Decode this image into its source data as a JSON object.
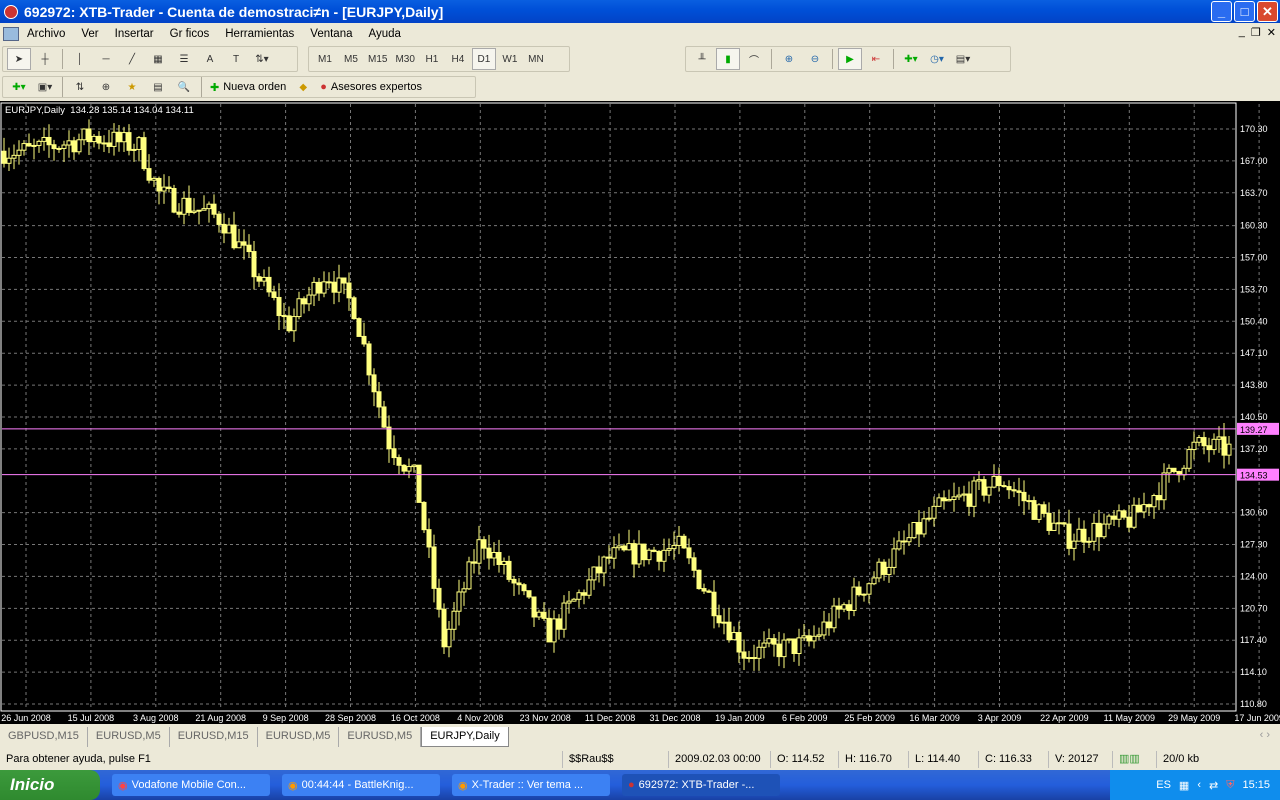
{
  "window": {
    "title": "692972: XTB-Trader - Cuenta de demostraci≠n - [EURJPY,Daily]"
  },
  "menu": [
    "Archivo",
    "Ver",
    "Insertar",
    "Gr ficos",
    "Herramientas",
    "Ventana",
    "Ayuda"
  ],
  "timeframes": [
    "M1",
    "M5",
    "M15",
    "M30",
    "H1",
    "H4",
    "D1",
    "W1",
    "MN"
  ],
  "active_timeframe": "D1",
  "toolbar2": {
    "new_order": "Nueva orden",
    "experts": "Asesores expertos"
  },
  "chart": {
    "header": "EURJPY,Daily  134.28 135.14 134.04 134.11",
    "price_labels": [
      "170.30",
      "167.00",
      "163.70",
      "160.30",
      "157.00",
      "153.70",
      "150.40",
      "147.10",
      "143.80",
      "140.50",
      "137.20",
      "130.60",
      "127.30",
      "124.00",
      "120.70",
      "117.40",
      "114.10",
      "110.80"
    ],
    "date_labels": [
      "26 Jun 2008",
      "15 Jul 2008",
      "3 Aug 2008",
      "21 Aug 2008",
      "9 Sep 2008",
      "28 Sep 2008",
      "16 Oct 2008",
      "4 Nov 2008",
      "23 Nov 2008",
      "11 Dec 2008",
      "31 Dec 2008",
      "19 Jan 2009",
      "6 Feb 2009",
      "25 Feb 2009",
      "16 Mar 2009",
      "3 Apr 2009",
      "22 Apr 2009",
      "11 May 2009",
      "29 May 2009",
      "17 Jun 2009"
    ],
    "hlines": [
      {
        "price": "139.27",
        "color": "#ff80ff"
      },
      {
        "price": "134.53",
        "color": "#ff80ff"
      }
    ],
    "candle_color": "#ffff80",
    "price_path": [
      [
        "26 Jun 2008",
        168
      ],
      [
        "15 Jul 2008",
        169.5
      ],
      [
        "28 Jul 2008",
        168.5
      ],
      [
        "3 Aug 2008",
        163.5
      ],
      [
        "21 Aug 2008",
        161
      ],
      [
        "9 Sep 2008",
        150
      ],
      [
        "20 Sep 2008",
        155.5
      ],
      [
        "28 Sep 2008",
        152
      ],
      [
        "8 Oct 2008",
        138
      ],
      [
        "16 Oct 2008",
        134
      ],
      [
        "24 Oct 2008",
        117
      ],
      [
        "4 Nov 2008",
        128
      ],
      [
        "23 Nov 2008",
        118
      ],
      [
        "11 Dec 2008",
        126
      ],
      [
        "31 Dec 2008",
        127
      ],
      [
        "19 Jan 2009",
        116
      ],
      [
        "6 Feb 2009",
        117
      ],
      [
        "25 Feb 2009",
        124
      ],
      [
        "16 Mar 2009",
        131
      ],
      [
        "3 Apr 2009",
        134
      ],
      [
        "22 Apr 2009",
        128
      ],
      [
        "11 May 2009",
        130
      ],
      [
        "29 May 2009",
        137.5
      ],
      [
        "12 Jun 2009",
        137
      ],
      [
        "17 Jun 2009",
        134
      ]
    ]
  },
  "tabs": [
    "GBPUSD,M15",
    "EURUSD,M5",
    "EURUSD,M15",
    "EURUSD,M5",
    "EURUSD,M5",
    "EURJPY,Daily"
  ],
  "active_tab": 5,
  "status": {
    "help": "Para obtener ayuda, pulse F1",
    "profile": "$$Rau$$",
    "time": "2009.02.03 00:00",
    "open": "O: 114.52",
    "high": "H: 116.70",
    "low": "L: 114.40",
    "close": "C: 116.33",
    "volume": "V: 20127",
    "traffic": "20/0 kb"
  },
  "taskbar": {
    "start": "Inicio",
    "tasks": [
      "Vodafone Mobile Con...",
      "00:44:44 - BattleKnig...",
      "X-Trader :: Ver tema ...",
      "692972: XTB-Trader -..."
    ],
    "lang": "ES",
    "clock": "15:15"
  }
}
